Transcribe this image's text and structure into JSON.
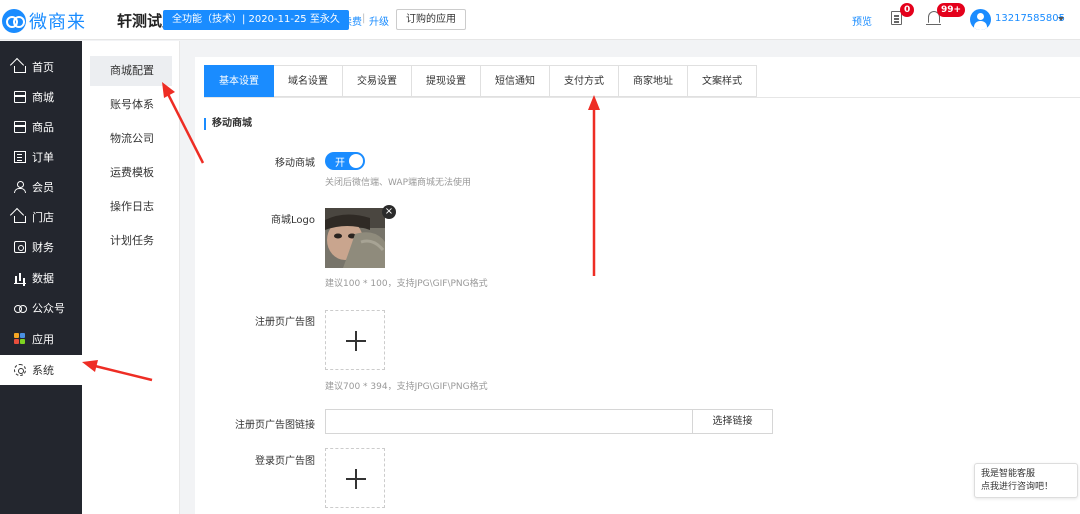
{
  "header": {
    "logo_text": "微商来",
    "account_name": "轩测试账号",
    "plan_badge": "全功能（技术）| 2020-11-25 至永久",
    "renew_label": "续费",
    "separator": "|",
    "upgrade_label": "升级",
    "subscribed_apps_label": "订购的应用",
    "preview_label": "预览",
    "doc_badge": "0",
    "bell_badge": "99+",
    "user_phone": "13217585805"
  },
  "nav": {
    "items": [
      {
        "label": "首页",
        "icon": "home-icon"
      },
      {
        "label": "商城",
        "icon": "shop-icon"
      },
      {
        "label": "商品",
        "icon": "goods-icon"
      },
      {
        "label": "订单",
        "icon": "order-icon"
      },
      {
        "label": "会员",
        "icon": "member-icon"
      },
      {
        "label": "门店",
        "icon": "store-icon"
      },
      {
        "label": "财务",
        "icon": "finance-icon"
      },
      {
        "label": "数据",
        "icon": "data-icon"
      },
      {
        "label": "公众号",
        "icon": "official-account-icon"
      },
      {
        "label": "应用",
        "icon": "apps-icon"
      },
      {
        "label": "系统",
        "icon": "gear-icon",
        "active": true
      }
    ]
  },
  "subnav": {
    "items": [
      {
        "label": "商城配置",
        "active": true
      },
      {
        "label": "账号体系"
      },
      {
        "label": "物流公司"
      },
      {
        "label": "运费模板"
      },
      {
        "label": "操作日志"
      },
      {
        "label": "计划任务"
      }
    ]
  },
  "tabs": [
    {
      "label": "基本设置",
      "active": true
    },
    {
      "label": "域名设置"
    },
    {
      "label": "交易设置"
    },
    {
      "label": "提现设置"
    },
    {
      "label": "短信通知"
    },
    {
      "label": "支付方式"
    },
    {
      "label": "商家地址"
    },
    {
      "label": "文案样式"
    }
  ],
  "form": {
    "section_title": "移动商城",
    "mobile_mall_label": "移动商城",
    "mobile_mall_toggle": "开",
    "mobile_mall_hint": "关闭后微信端、WAP端商城无法使用",
    "logo_label": "商城Logo",
    "logo_remove": "×",
    "logo_hint": "建议100 * 100，支持JPG\\GIF\\PNG格式",
    "register_ad_label": "注册页广告图",
    "register_ad_hint": "建议700 * 394，支持JPG\\GIF\\PNG格式",
    "register_ad_link_label": "注册页广告图链接",
    "register_ad_link_value": "",
    "select_link_label": "选择链接",
    "login_ad_label": "登录页广告图"
  },
  "chat": {
    "line1": "我是智能客服",
    "line2": "点我进行咨询吧！"
  },
  "colors": {
    "accent": "#1a8cff",
    "nav_bg": "#23262e",
    "badge_red": "#e4001b",
    "annotation_arrow": "#ee2d24"
  }
}
